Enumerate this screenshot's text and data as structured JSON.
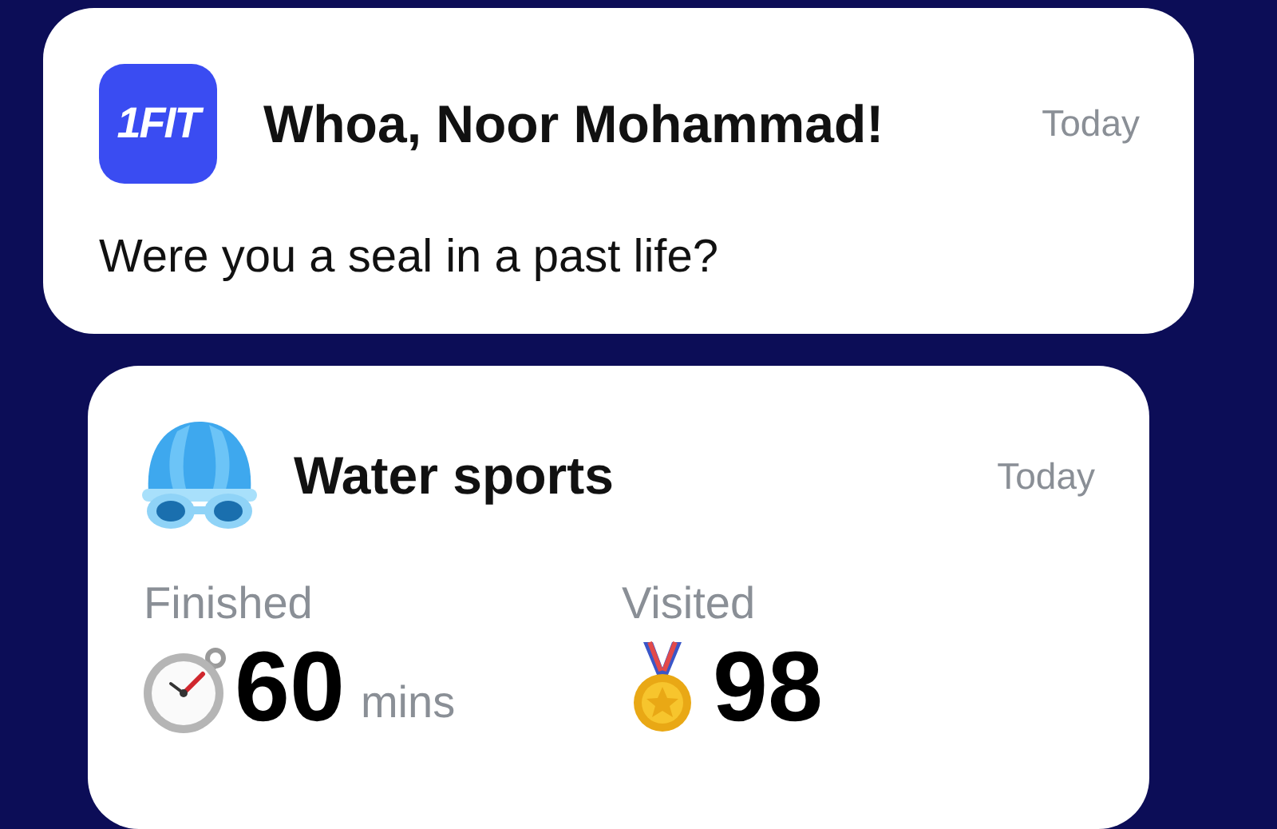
{
  "notifications": [
    {
      "kind": "message",
      "app_logo": "1FIT",
      "title": "Whoa, Noor Mohammad!",
      "time": "Today",
      "body": "Were you a seal in a past life?"
    },
    {
      "kind": "workout",
      "title": "Water sports",
      "time": "Today",
      "stats": [
        {
          "kind": "stopwatch",
          "label": "Finished",
          "value": "60",
          "unit": "mins"
        },
        {
          "kind": "medal",
          "label": "Visited",
          "value": "98"
        }
      ]
    }
  ]
}
